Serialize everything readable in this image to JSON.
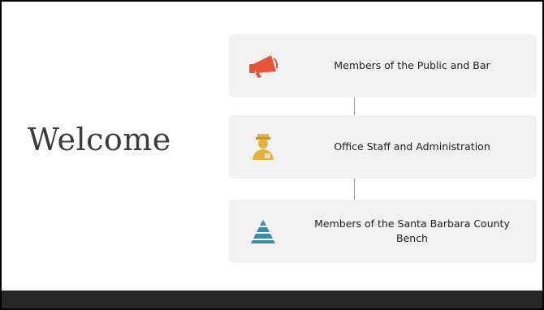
{
  "title": "Welcome",
  "cards": [
    {
      "label": "Members of the Public and Bar",
      "icon": "megaphone-icon",
      "icon_color": "#e8543a"
    },
    {
      "label": "Office Staff and Administration",
      "icon": "staff-person-icon",
      "icon_color": "#e3b23c"
    },
    {
      "label": "Members of the Santa Barbara County Bench",
      "icon": "pyramid-icon",
      "icon_color": "#3b8ea5"
    }
  ],
  "colors": {
    "background": "#ffffff",
    "card": "#f2f2f2",
    "footer": "#262626",
    "connector": "#9a9a9a"
  }
}
